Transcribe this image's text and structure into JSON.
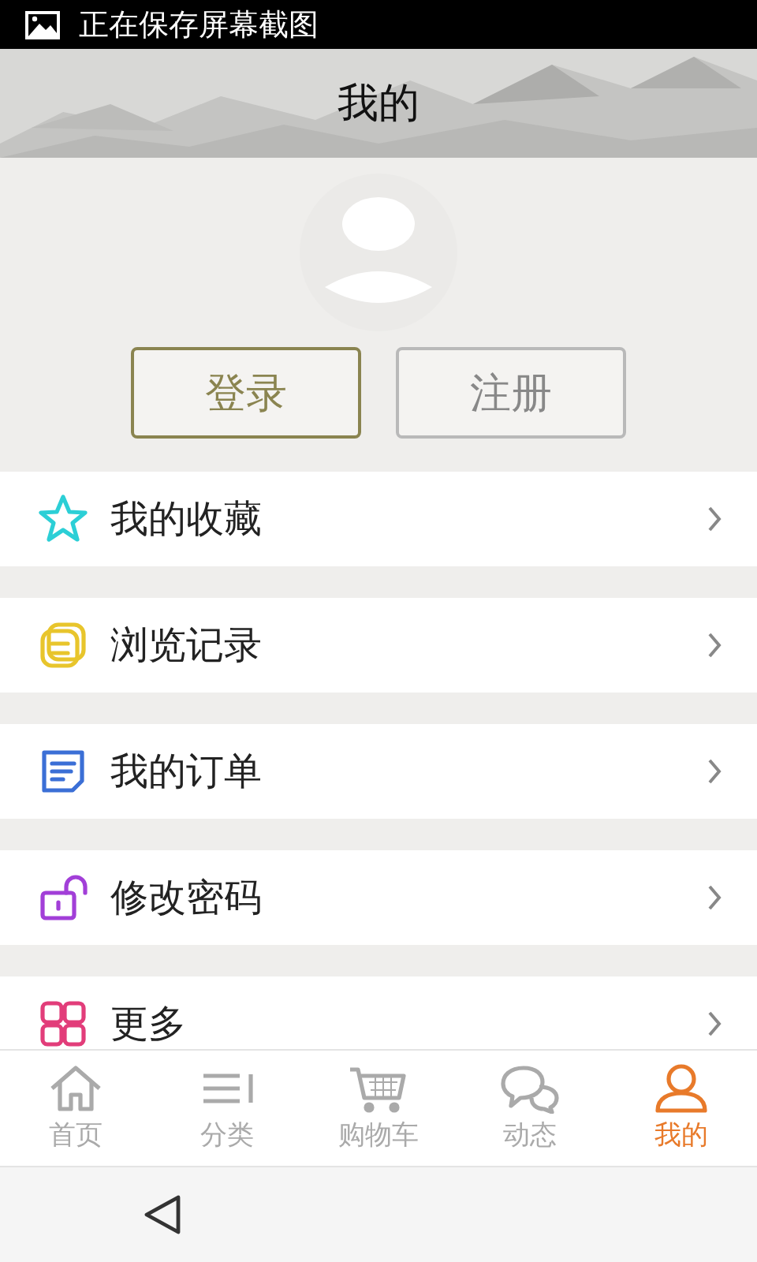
{
  "status_bar": {
    "text": "正在保存屏幕截图"
  },
  "header": {
    "title": "我的"
  },
  "account_buttons": [
    {
      "label": "登录",
      "kind": "primary"
    },
    {
      "label": "注册",
      "kind": "secondary"
    }
  ],
  "menu": [
    {
      "label": "我的收藏",
      "kind": "star",
      "color": "#2ccfd6"
    },
    {
      "label": "浏览记录",
      "kind": "history",
      "color": "#e8c52c"
    },
    {
      "label": "我的订单",
      "kind": "order",
      "color": "#3b6fd6"
    },
    {
      "label": "修改密码",
      "kind": "lock",
      "color": "#a23fd8"
    },
    {
      "label": "更多",
      "kind": "grid",
      "color": "#e23d7a"
    }
  ],
  "tab_bar": [
    {
      "label": "首页",
      "kind": "home",
      "selected": false
    },
    {
      "label": "分类",
      "kind": "list",
      "selected": false
    },
    {
      "label": "购物车",
      "kind": "cart",
      "selected": false
    },
    {
      "label": "动态",
      "kind": "chat",
      "selected": false
    },
    {
      "label": "我的",
      "kind": "person",
      "selected": true
    }
  ]
}
